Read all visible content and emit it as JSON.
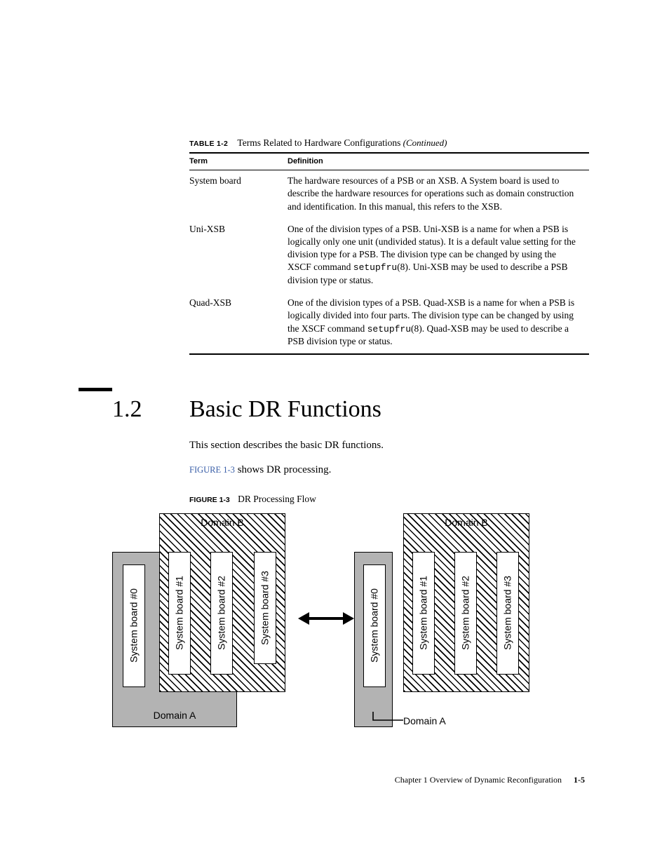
{
  "table": {
    "label": "TABLE 1-2",
    "title": "Terms Related to Hardware Configurations",
    "continued": "(Continued)",
    "headers": {
      "term": "Term",
      "definition": "Definition"
    },
    "rows": [
      {
        "term": "System board",
        "def": "The hardware resources of a PSB or an XSB. A System board is used to describe the hardware resources for operations such as domain construction and identification. In this manual, this refers to the XSB."
      },
      {
        "term": "Uni-XSB",
        "def_pre": "One of the division types of a PSB. Uni-XSB is a name for when a PSB is logically only one unit (undivided status). It is a default value setting for the division type for a PSB. The division type can be changed by using the XSCF command ",
        "def_cmd": "setupfru",
        "def_arg": "(8)",
        "def_post": ". Uni-XSB may be used to describe a PSB division type or status."
      },
      {
        "term": "Quad-XSB",
        "def_pre": "One of the division types of a PSB. Quad-XSB is a name for when a PSB is logically divided into four parts. The division type can be changed by using the XSCF command ",
        "def_cmd": "setupfru",
        "def_arg": "(8)",
        "def_post": ". Quad-XSB may be used to describe a PSB division type or status."
      }
    ]
  },
  "section": {
    "num": "1.2",
    "title": "Basic DR Functions",
    "intro": "This section describes the basic DR functions.",
    "link": "FIGURE 1-3",
    "link_tail": " shows DR processing."
  },
  "figure": {
    "label": "FIGURE 1-3",
    "title": "DR Processing Flow",
    "left": {
      "domainA": "Domain A",
      "domainB": "Domain B",
      "boards": [
        "System board #0",
        "System board #1",
        "System board #2",
        "System board #3"
      ]
    },
    "right": {
      "domainA": "Domain A",
      "domainB": "Domain B",
      "boards": [
        "System board #0",
        "System board #1",
        "System board #2",
        "System board #3"
      ]
    }
  },
  "footer": {
    "chapter": "Chapter 1   Overview of Dynamic Reconfiguration",
    "page": "1-5"
  }
}
